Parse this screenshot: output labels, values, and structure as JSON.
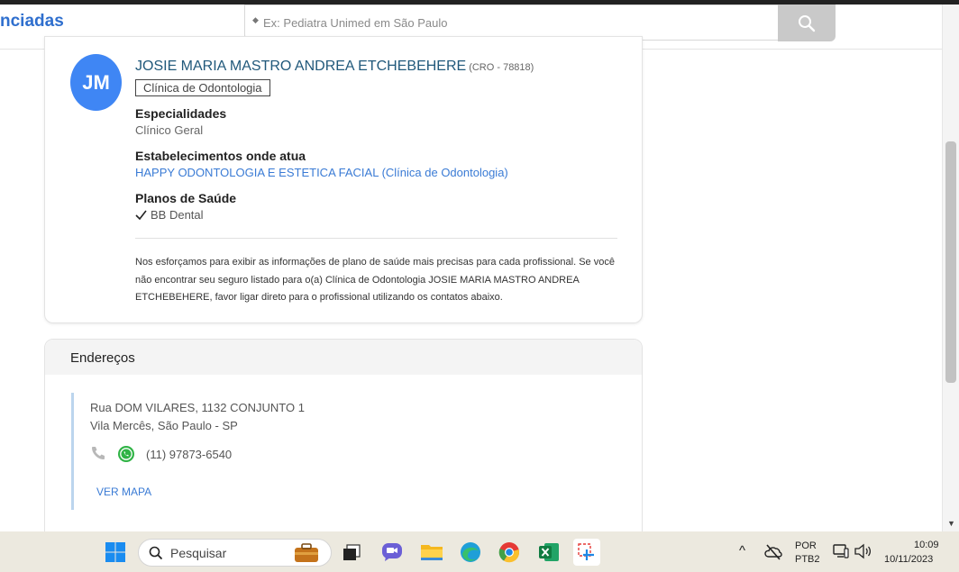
{
  "header": {
    "brand": "nciadas",
    "search_placeholder": "Ex: Pediatra Unimed em São Paulo"
  },
  "profile": {
    "initials": "JM",
    "name": "JOSIE MARIA MASTRO ANDREA ETCHEBEHERE",
    "cro": "(CRO - 78818)",
    "type": "Clínica de Odontologia",
    "sections": {
      "specialties_title": "Especialidades",
      "specialties_value": "Clínico Geral",
      "establishments_title": "Estabelecimentos onde atua",
      "establishments_value": "HAPPY ODONTOLOGIA E ESTETICA FACIAL (Clínica de Odontologia)",
      "plans_title": "Planos de Saúde",
      "plans_value": "BB Dental"
    },
    "disclaimer": "Nos esforçamos para exibir as informações de plano de saúde mais precisas para cada profissional. Se você não encontrar seu seguro listado para o(a) Clínica de Odontologia JOSIE MARIA MASTRO ANDREA ETCHEBEHERE, favor ligar direto para o profissional utilizando os contatos abaixo."
  },
  "addresses": {
    "title": "Endereços",
    "line1": "Rua DOM VILARES, 1132 CONJUNTO 1",
    "line2": "Vila Mercês, São Paulo - SP",
    "phone": "(11) 97873-6540",
    "map_link": "VER MAPA"
  },
  "taskbar": {
    "search_label": "Pesquisar",
    "lang_top": "POR",
    "lang_bottom": "PTB2",
    "time": "10:09",
    "date": "10/11/2023"
  },
  "colors": {
    "accent": "#3a7bd5",
    "avatar": "#3f86f4",
    "name": "#21597b"
  }
}
